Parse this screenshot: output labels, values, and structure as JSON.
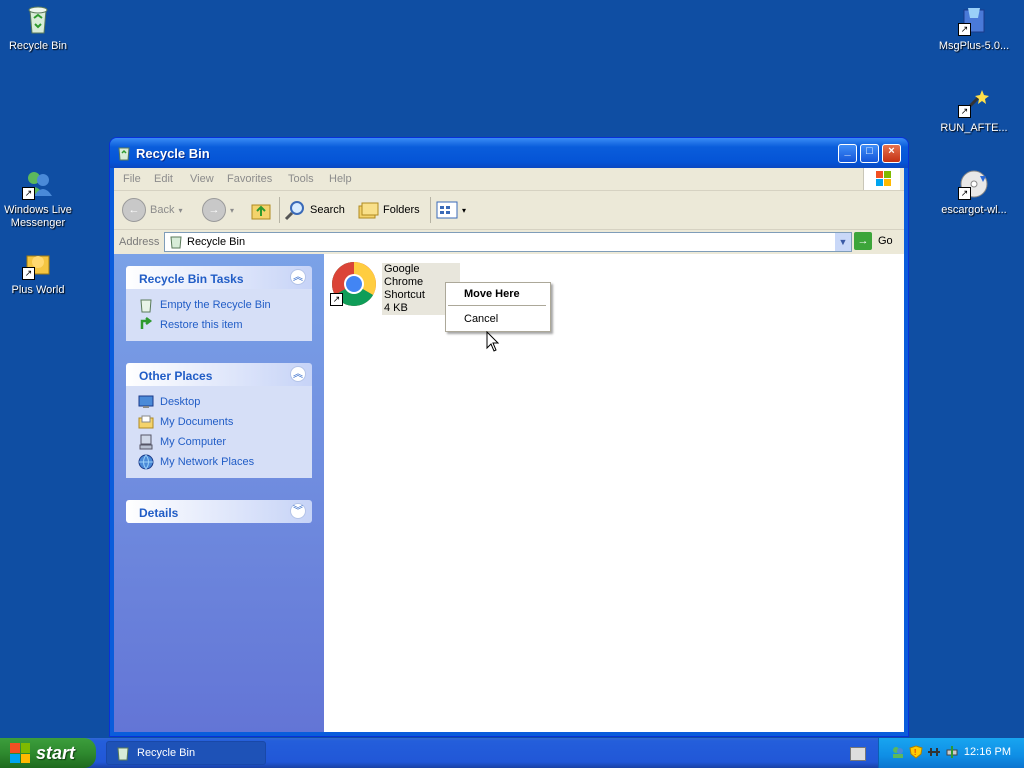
{
  "desktop": {
    "icons": [
      {
        "label": "Recycle Bin"
      },
      {
        "label": "MsgPlus-5.0..."
      },
      {
        "label": "RUN_AFTE..."
      },
      {
        "label": "Windows Live Messenger"
      },
      {
        "label": "escargot-wl..."
      },
      {
        "label": "Plus World"
      }
    ]
  },
  "window": {
    "title": "Recycle Bin",
    "menu": [
      "File",
      "Edit",
      "View",
      "Favorites",
      "Tools",
      "Help"
    ],
    "toolbar": {
      "back": "Back",
      "search": "Search",
      "folders": "Folders"
    },
    "address": {
      "label": "Address",
      "value": "Recycle Bin",
      "go": "Go"
    },
    "taskpane": {
      "tasks": {
        "title": "Recycle Bin Tasks",
        "links": [
          "Empty the Recycle Bin",
          "Restore this item"
        ]
      },
      "places": {
        "title": "Other Places",
        "links": [
          "Desktop",
          "My Documents",
          "My Computer",
          "My Network Places"
        ]
      },
      "details": {
        "title": "Details"
      }
    },
    "file": {
      "name_line1": "Google Chrome",
      "name_line2": "Shortcut",
      "size": "4 KB"
    }
  },
  "context_menu": {
    "items": [
      "Move Here",
      "Cancel"
    ]
  },
  "taskbar": {
    "start": "start",
    "task": "Recycle Bin",
    "clock": "12:16 PM"
  },
  "colors": {
    "desktop": "#0f4ea3",
    "title_bar": "#0a5ddb",
    "task_pane": "#7ba2e7",
    "start_button": "#2f8a2f"
  }
}
